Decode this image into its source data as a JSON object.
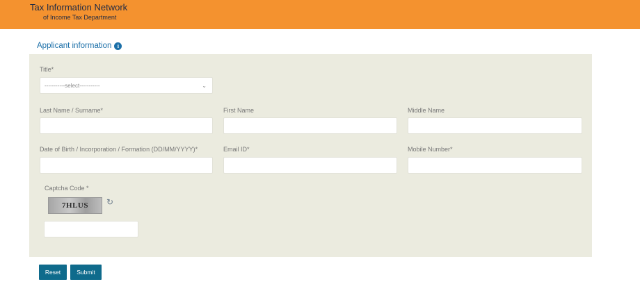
{
  "header": {
    "title": "Tax Information Network",
    "subtitle": "of Income Tax Department"
  },
  "section": {
    "title": "Applicant information",
    "info_icon": "i"
  },
  "form": {
    "title_label": "Title*",
    "title_select_value": "-----------select-----------",
    "last_name_label": "Last Name / Surname*",
    "first_name_label": "First Name",
    "middle_name_label": "Middle Name",
    "dob_label": "Date of Birth / Incorporation / Formation (DD/MM/YYYY)*",
    "email_label": "Email ID*",
    "mobile_label": "Mobile Number*",
    "captcha_label": "Captcha Code *",
    "captcha_text": "7HLUS"
  },
  "buttons": {
    "reset": "Reset",
    "submit": "Submit"
  },
  "colors": {
    "header_bg": "#f4922f",
    "panel_bg": "#ebebdf",
    "button_bg": "#0f6b8c",
    "accent": "#1b6fa8"
  }
}
